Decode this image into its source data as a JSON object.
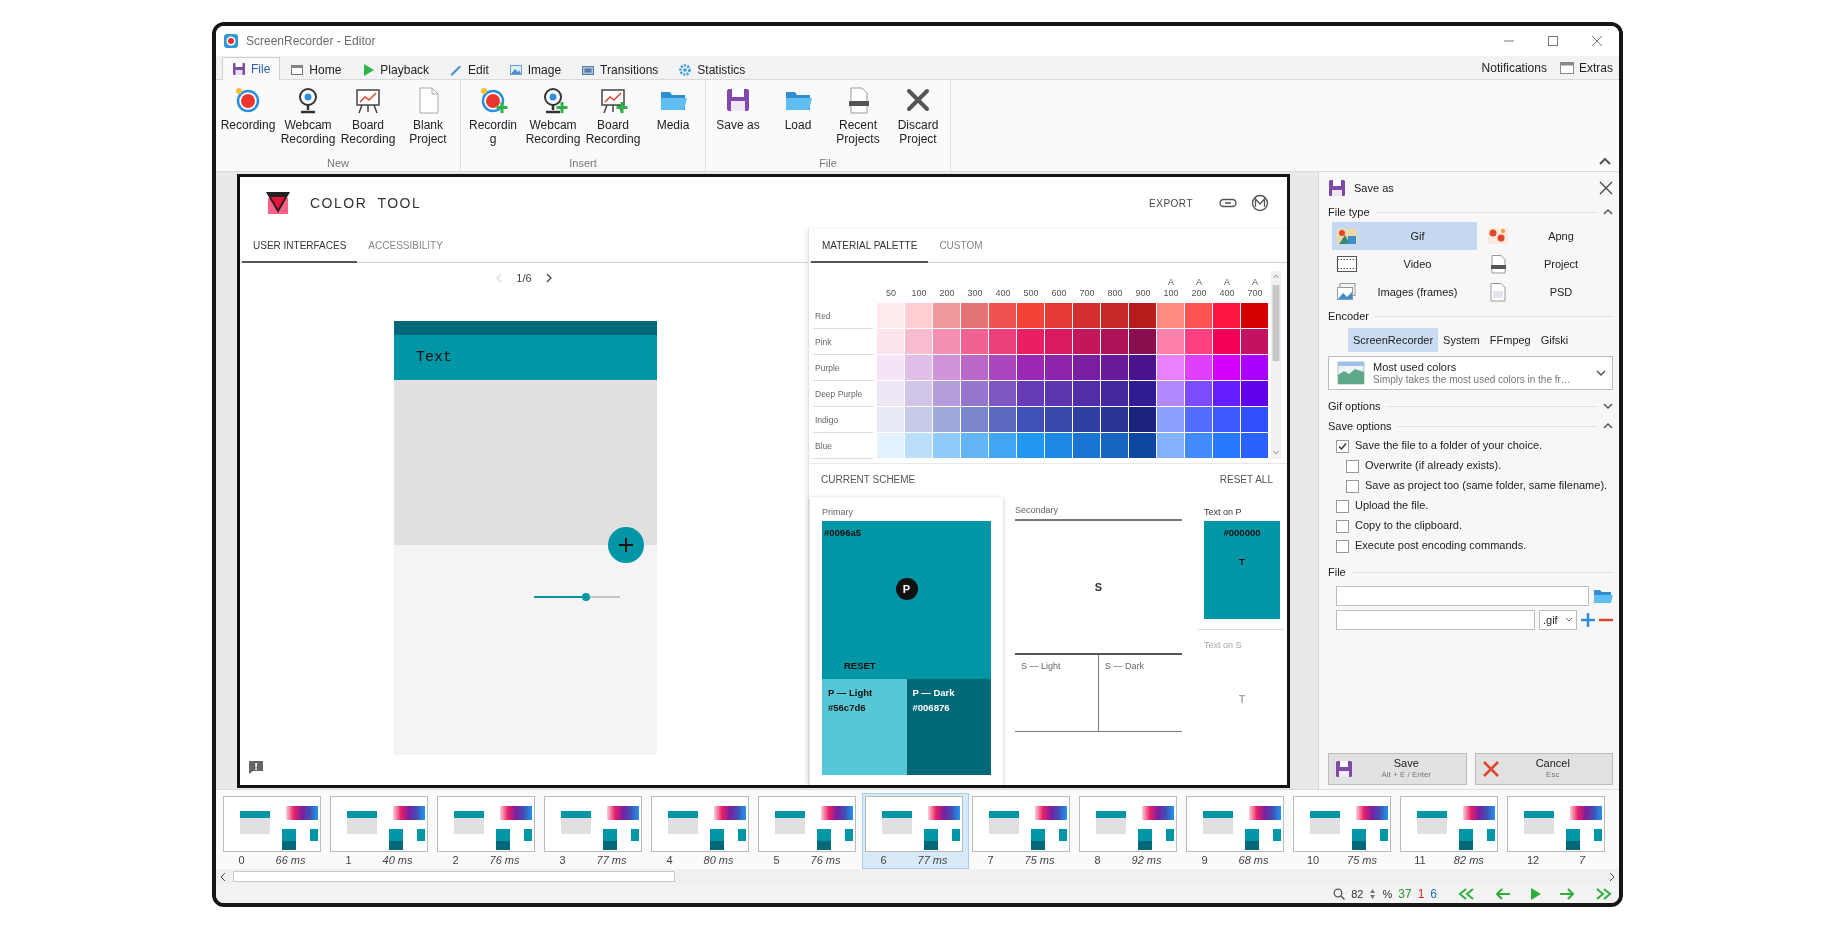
{
  "window": {
    "title": "ScreenRecorder - Editor"
  },
  "menu_tabs": [
    {
      "label": "File",
      "selected": true
    },
    {
      "label": "Home",
      "selected": false
    },
    {
      "label": "Playback",
      "selected": false
    },
    {
      "label": "Edit",
      "selected": false
    },
    {
      "label": "Image",
      "selected": false
    },
    {
      "label": "Transitions",
      "selected": false
    },
    {
      "label": "Statistics",
      "selected": false
    }
  ],
  "menu_right": [
    "Notifications",
    "Extras"
  ],
  "ribbon": [
    {
      "label": "New",
      "buttons": [
        "Recording",
        "Webcam Recording",
        "Board Recording",
        "Blank Project"
      ]
    },
    {
      "label": "Insert",
      "buttons": [
        "Recordin\ng",
        "Webcam Recording",
        "Board Recording",
        "Media"
      ]
    },
    {
      "label": "File",
      "buttons": [
        "Save as",
        "Load",
        "Recent Projects",
        "Discard Project"
      ]
    }
  ],
  "color_tool": {
    "title": "COLOR TOOL",
    "header_action": "EXPORT",
    "left_tabs": [
      {
        "label": "USER INTERFACES",
        "selected": true
      },
      {
        "label": "ACCESSIBILITY",
        "selected": false
      }
    ],
    "pager": "1/6",
    "preview": {
      "app_bar_text": "Text",
      "slider": {
        "level": 0.6
      }
    },
    "right_tabs": [
      {
        "label": "MATERIAL PALETTE",
        "selected": true
      },
      {
        "label": "CUSTOM",
        "selected": false
      }
    ],
    "palette": {
      "columns": [
        {
          "label": "50"
        },
        {
          "label": "100"
        },
        {
          "label": "200"
        },
        {
          "label": "300"
        },
        {
          "label": "400"
        },
        {
          "label": "500"
        },
        {
          "label": "600"
        },
        {
          "label": "700"
        },
        {
          "label": "800"
        },
        {
          "label": "900"
        },
        {
          "prefix": "A",
          "label": "100"
        },
        {
          "prefix": "A",
          "label": "200"
        },
        {
          "prefix": "A",
          "label": "400"
        },
        {
          "prefix": "A",
          "label": "700"
        }
      ],
      "rows": [
        {
          "name": "Red",
          "swatches": [
            {
              "color": "#ffebee"
            },
            {
              "color": "#ffcdd2"
            },
            {
              "color": "#ef9a9a"
            },
            {
              "color": "#e57373"
            },
            {
              "color": "#ef5350"
            },
            {
              "color": "#f44336"
            },
            {
              "color": "#e53935"
            },
            {
              "color": "#d32f2f"
            },
            {
              "color": "#c62828"
            },
            {
              "color": "#b71c1c"
            },
            {
              "color": "#ff8a80"
            },
            {
              "color": "#ff5252"
            },
            {
              "color": "#ff1744"
            },
            {
              "color": "#d50000"
            }
          ]
        },
        {
          "name": "Pink",
          "swatches": [
            {
              "color": "#fce4ec"
            },
            {
              "color": "#f8bbd0"
            },
            {
              "color": "#f48fb1"
            },
            {
              "color": "#f06292"
            },
            {
              "color": "#ec407a"
            },
            {
              "color": "#e91e63"
            },
            {
              "color": "#d81b60"
            },
            {
              "color": "#c2185b"
            },
            {
              "color": "#ad1457"
            },
            {
              "color": "#880e4f"
            },
            {
              "color": "#ff80ab"
            },
            {
              "color": "#ff4081"
            },
            {
              "color": "#f50057"
            },
            {
              "color": "#c51162"
            }
          ]
        },
        {
          "name": "Purple",
          "swatches": [
            {
              "color": "#f3e5f5"
            },
            {
              "color": "#e1bee7"
            },
            {
              "color": "#ce93d8"
            },
            {
              "color": "#ba68c8"
            },
            {
              "color": "#ab47bc"
            },
            {
              "color": "#9c27b0"
            },
            {
              "color": "#8e24aa"
            },
            {
              "color": "#7b1fa2"
            },
            {
              "color": "#6a1b9a"
            },
            {
              "color": "#4a148c"
            },
            {
              "color": "#ea80fc"
            },
            {
              "color": "#e040fb"
            },
            {
              "color": "#d500f9"
            },
            {
              "color": "#aa00ff"
            }
          ]
        },
        {
          "name": "Deep Purple",
          "swatches": [
            {
              "color": "#ede7f6"
            },
            {
              "color": "#d1c4e9"
            },
            {
              "color": "#b39ddb"
            },
            {
              "color": "#9575cd"
            },
            {
              "color": "#7e57c2"
            },
            {
              "color": "#673ab7"
            },
            {
              "color": "#5e35b1"
            },
            {
              "color": "#512da8"
            },
            {
              "color": "#4527a0"
            },
            {
              "color": "#311b92"
            },
            {
              "color": "#b388ff"
            },
            {
              "color": "#7c4dff"
            },
            {
              "color": "#651fff"
            },
            {
              "color": "#6200ea"
            }
          ]
        },
        {
          "name": "Indigo",
          "swatches": [
            {
              "color": "#e8eaf6"
            },
            {
              "color": "#c5cae9"
            },
            {
              "color": "#9fa8da"
            },
            {
              "color": "#7986cb"
            },
            {
              "color": "#5c6bc0"
            },
            {
              "color": "#3f51b5"
            },
            {
              "color": "#3949ab"
            },
            {
              "color": "#303f9f"
            },
            {
              "color": "#283593"
            },
            {
              "color": "#1a237e"
            },
            {
              "color": "#8c9eff"
            },
            {
              "color": "#536dfe"
            },
            {
              "color": "#3d5afe"
            },
            {
              "color": "#304ffe"
            }
          ]
        },
        {
          "name": "Blue",
          "swatches": [
            {
              "color": "#e3f2fd"
            },
            {
              "color": "#bbdefb"
            },
            {
              "color": "#90caf9"
            },
            {
              "color": "#64b5f6"
            },
            {
              "color": "#42a5f5"
            },
            {
              "color": "#2196f3"
            },
            {
              "color": "#1e88e5"
            },
            {
              "color": "#1976d2"
            },
            {
              "color": "#1565c0"
            },
            {
              "color": "#0d47a1"
            },
            {
              "color": "#82b1ff"
            },
            {
              "color": "#448aff"
            },
            {
              "color": "#2979ff"
            },
            {
              "color": "#2962ff"
            }
          ]
        }
      ]
    },
    "scheme": {
      "title": "CURRENT SCHEME",
      "reset_all": "RESET ALL",
      "primary": {
        "label": "Primary",
        "value": "#0096a5",
        "color": "#0096a5",
        "badge": "P",
        "reset": "RESET"
      },
      "primary_variants": [
        {
          "label": "P — Light",
          "value": "#56c7d6",
          "color": "#56c7d6"
        },
        {
          "label": "P — Dark",
          "value": "#006876",
          "color": "#006876"
        }
      ],
      "secondary": {
        "label": "Secondary",
        "badge": "S"
      },
      "secondary_variants": [
        {
          "label": "S — Light"
        },
        {
          "label": "S — Dark"
        }
      ],
      "text_on_primary": {
        "label": "Text on P",
        "value": "#000000",
        "badge": "T",
        "disabled": false
      },
      "text_on_secondary": {
        "label": "Text on S",
        "badge": "T",
        "disabled": true
      }
    }
  },
  "save_panel": {
    "title": "Save as",
    "file_type": {
      "label": "File type",
      "expanded": true,
      "options": [
        {
          "label": "Gif",
          "selected": true
        },
        {
          "label": "Apng",
          "selected": false
        },
        {
          "label": "Video",
          "selected": false
        },
        {
          "label": "Project",
          "selected": false
        },
        {
          "label": "Images (frames)",
          "selected": false
        },
        {
          "label": "PSD",
          "selected": false
        }
      ]
    },
    "encoder": {
      "label": "Encoder",
      "tabs": [
        {
          "label": "ScreenRecorder",
          "selected": true
        },
        {
          "label": "System",
          "selected": false
        },
        {
          "label": "FFmpeg",
          "selected": false
        },
        {
          "label": "Gifski",
          "selected": false
        }
      ],
      "dropdown": {
        "title": "Most used colors",
        "description": "Simply takes the most used colors in the fr…"
      }
    },
    "gif_options": {
      "label": "Gif options",
      "expanded": false
    },
    "save_options": {
      "label": "Save options",
      "expanded": true,
      "checkboxes": [
        {
          "label": "Save the file to a folder of your choice.",
          "checked": true,
          "children": [
            {
              "label": "Overwrite (if already exists).",
              "checked": false
            },
            {
              "label": "Save as project too (same folder, same filename).",
              "checked": false
            }
          ]
        },
        {
          "label": "Upload the file.",
          "checked": false
        },
        {
          "label": "Copy to the clipboard.",
          "checked": false
        },
        {
          "label": "Execute post encoding commands.",
          "checked": false
        }
      ]
    },
    "file": {
      "label": "File",
      "extension": ".gif"
    },
    "buttons": [
      {
        "label": "Save",
        "shortcut": "Alt + E / Enter"
      },
      {
        "label": "Cancel",
        "shortcut": "Esc"
      }
    ]
  },
  "frames": [
    {
      "index": "0",
      "duration": "66 ms",
      "selected": false
    },
    {
      "index": "1",
      "duration": "40 ms",
      "selected": false
    },
    {
      "index": "2",
      "duration": "76 ms",
      "selected": false
    },
    {
      "index": "3",
      "duration": "77 ms",
      "selected": false
    },
    {
      "index": "4",
      "duration": "80 ms",
      "selected": false
    },
    {
      "index": "5",
      "duration": "76 ms",
      "selected": false
    },
    {
      "index": "6",
      "duration": "77 ms",
      "selected": true
    },
    {
      "index": "7",
      "duration": "75 ms",
      "selected": false
    },
    {
      "index": "8",
      "duration": "92 ms",
      "selected": false
    },
    {
      "index": "9",
      "duration": "68 ms",
      "selected": false
    },
    {
      "index": "10",
      "duration": "75 ms",
      "selected": false
    },
    {
      "index": "11",
      "duration": "82 ms",
      "selected": false
    },
    {
      "index": "12",
      "duration": "7",
      "selected": false
    }
  ],
  "status_bar": {
    "zoom": "82",
    "zoom_unit": "%",
    "counts": [
      {
        "value": "37",
        "color": "#2e9a2e"
      },
      {
        "value": "1",
        "color": "#d02828"
      },
      {
        "value": "6",
        "color": "#2870c8"
      }
    ]
  }
}
